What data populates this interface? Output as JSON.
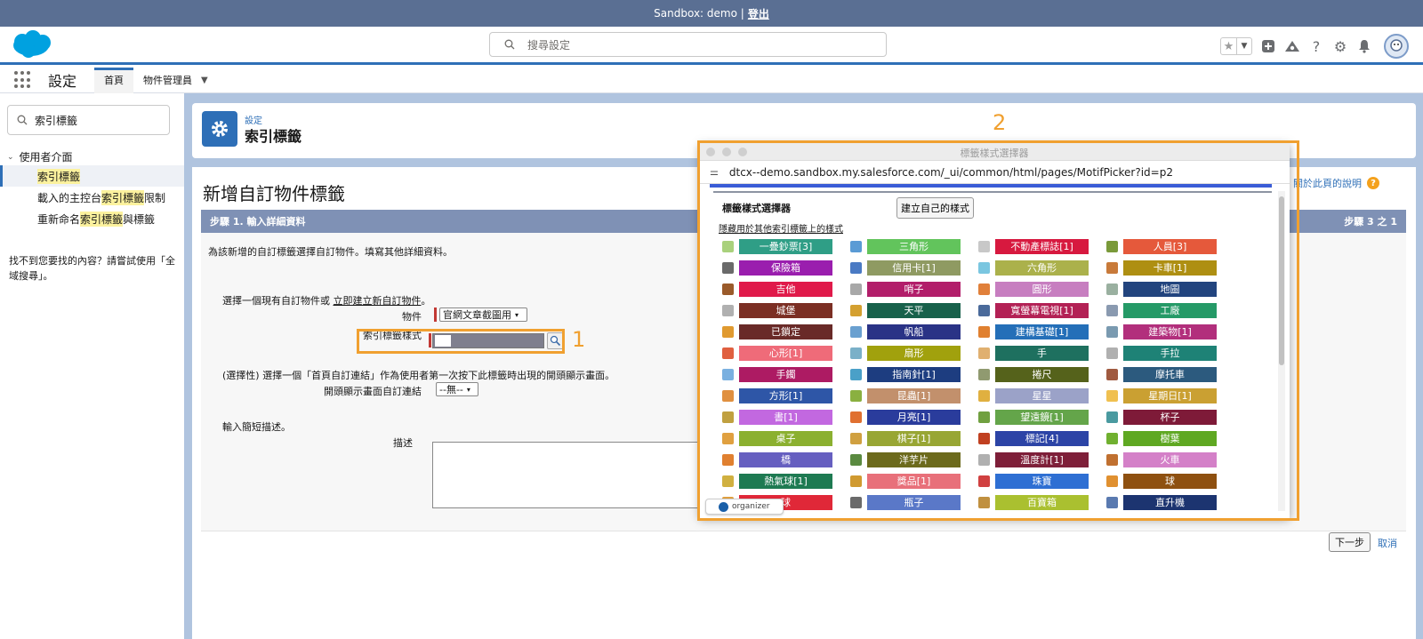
{
  "sandbox": {
    "label": "Sandbox: demo |",
    "logout": "登出"
  },
  "header": {
    "search_placeholder": "搜尋設定"
  },
  "nav": {
    "app_name": "設定",
    "tabs": [
      {
        "label": "首頁"
      },
      {
        "label": "物件管理員"
      }
    ]
  },
  "sidebar": {
    "quickfind_value": "索引標籤",
    "section": "使用者介面",
    "items": [
      {
        "before": "",
        "highlight": "索引標籤",
        "after": ""
      },
      {
        "before": "載入的主控台",
        "highlight": "索引標籤",
        "after": "限制"
      },
      {
        "before": "重新命名",
        "highlight": "索引標籤",
        "after": "與標籤"
      }
    ],
    "not_found": "找不到您要找的內容？請嘗試使用「全域搜尋」。"
  },
  "setup_header": {
    "subtitle": "設定",
    "title": "索引標籤"
  },
  "main": {
    "title": "新增自訂物件標籤",
    "help": "關於此頁的說明",
    "step_title": "步驟 1. 輸入詳細資料",
    "step_count": "步驟 3 之 1",
    "instructions": "為該新增的自訂標籤選擇自訂物件。填寫其他詳細資料。",
    "choose_prefix": "選擇一個現有自訂物件或",
    "choose_link": "立即建立新自訂物件",
    "choose_suffix": "。",
    "object_label": "物件",
    "object_value": "官網文章截圖用",
    "motif_label": "索引標籤樣式",
    "optional_text": "(選擇性) 選擇一個「首頁自訂連結」作為使用者第一次按下此標籤時出現的開頭顯示畫面。",
    "splash_label": "開頭顯示畫面自訂連結",
    "splash_value": "--無--",
    "desc_prompt": "輸入簡短描述。",
    "desc_label": "描述",
    "next": "下一步",
    "cancel": "取消"
  },
  "annotations": {
    "one": "1",
    "two": "2"
  },
  "popup": {
    "window_title": "標籤樣式選擇器",
    "url": "dtcx--demo.sandbox.my.salesforce.com/_ui/common/html/pages/MotifPicker?id=p2",
    "picker_title": "標籤樣式選擇器",
    "create_button": "建立自己的樣式",
    "hide_link": "隱藏用於其他索引標籤上的樣式",
    "styles": [
      {
        "label": "一疊鈔票[3]",
        "color": "#2f9e86",
        "icon": "#a9d17c"
      },
      {
        "label": "三角形",
        "color": "#62c45c",
        "icon": "#5a9bd5"
      },
      {
        "label": "不動產標誌[1]",
        "color": "#d7193f",
        "icon": "#c8c8c8"
      },
      {
        "label": "人員[3]",
        "color": "#e5593b",
        "icon": "#7a9a3a"
      },
      {
        "label": "保險箱",
        "color": "#9a1eae",
        "icon": "#6a6a6a"
      },
      {
        "label": "信用卡[1]",
        "color": "#8f9a62",
        "icon": "#4a7ac4"
      },
      {
        "label": "六角形",
        "color": "#abb14b",
        "icon": "#7ac6e0"
      },
      {
        "label": "卡車[1]",
        "color": "#ae8f12",
        "icon": "#c87a3a"
      },
      {
        "label": "吉他",
        "color": "#e01a4a",
        "icon": "#9a5a2a"
      },
      {
        "label": "哨子",
        "color": "#b21e6a",
        "icon": "#a8a8a8"
      },
      {
        "label": "圓形",
        "color": "#c77ec0",
        "icon": "#e0803a"
      },
      {
        "label": "地圖",
        "color": "#22447e",
        "icon": "#9ab0a0"
      },
      {
        "label": "城堡",
        "color": "#7b2f24",
        "icon": "#b0b0b0"
      },
      {
        "label": "天平",
        "color": "#18614b",
        "icon": "#d4a030"
      },
      {
        "label": "寬螢幕電視[1]",
        "color": "#b32155",
        "icon": "#4a6a9a"
      },
      {
        "label": "工廠",
        "color": "#259a67",
        "icon": "#8a9ab0"
      },
      {
        "label": "已鎖定",
        "color": "#692a28",
        "icon": "#e09a30"
      },
      {
        "label": "帆船",
        "color": "#2a3386",
        "icon": "#6aa0d0"
      },
      {
        "label": "建構基礎[1]",
        "color": "#246fb8",
        "icon": "#e08030"
      },
      {
        "label": "建築物[1]",
        "color": "#b22f7c",
        "icon": "#7a9ab0"
      },
      {
        "label": "心形[1]",
        "color": "#ef6b79",
        "icon": "#e06040"
      },
      {
        "label": "扇形",
        "color": "#a1a10d",
        "icon": "#7ab0c8"
      },
      {
        "label": "手",
        "color": "#1e705f",
        "icon": "#e0b070"
      },
      {
        "label": "手拉",
        "color": "#1e8276",
        "icon": "#b0b0b0"
      },
      {
        "label": "手鐲",
        "color": "#ad1b63",
        "icon": "#7ab0e0"
      },
      {
        "label": "指南針[1]",
        "color": "#1d3d80",
        "icon": "#4aa0c8"
      },
      {
        "label": "捲尺",
        "color": "#55621b",
        "icon": "#909a70"
      },
      {
        "label": "摩托車",
        "color": "#2c5a7e",
        "icon": "#a05a40"
      },
      {
        "label": "方形[1]",
        "color": "#2e56a7",
        "icon": "#e09040"
      },
      {
        "label": "昆蟲[1]",
        "color": "#c2906c",
        "icon": "#8ab040"
      },
      {
        "label": "星星",
        "color": "#9ba2c8",
        "icon": "#e0b040"
      },
      {
        "label": "星期日[1]",
        "color": "#caa032",
        "icon": "#f0c050"
      },
      {
        "label": "書[1]",
        "color": "#c268e0",
        "icon": "#c0a040"
      },
      {
        "label": "月亮[1]",
        "color": "#2a3c9c",
        "icon": "#e07030"
      },
      {
        "label": "望遠鏡[1]",
        "color": "#64a54a",
        "icon": "#70a040"
      },
      {
        "label": "杯子",
        "color": "#7e1a38",
        "icon": "#4a9aa0"
      },
      {
        "label": "桌子",
        "color": "#8bb030",
        "icon": "#e0a040"
      },
      {
        "label": "棋子[1]",
        "color": "#98a634",
        "icon": "#d0a040"
      },
      {
        "label": "標記[4]",
        "color": "#2c44a6",
        "icon": "#c04020"
      },
      {
        "label": "樹葉",
        "color": "#5fa822",
        "icon": "#70b030"
      },
      {
        "label": "橋",
        "color": "#665fc0",
        "icon": "#e08030"
      },
      {
        "label": "洋芋片",
        "color": "#6c6a1c",
        "icon": "#5a8a40"
      },
      {
        "label": "溫度計[1]",
        "color": "#7e1f39",
        "icon": "#b0b0b0"
      },
      {
        "label": "火車",
        "color": "#d480c8",
        "icon": "#c07030"
      },
      {
        "label": "熱氣球[1]",
        "color": "#1e7a52",
        "icon": "#d0b040"
      },
      {
        "label": "獎品[1]",
        "color": "#e8707a",
        "icon": "#d09a30"
      },
      {
        "label": "珠寶",
        "color": "#2e6fd3",
        "icon": "#d04040"
      },
      {
        "label": "球",
        "color": "#8e5010",
        "icon": "#e09030"
      },
      {
        "label": "球",
        "color": "#e02838",
        "icon": "#e0a040"
      },
      {
        "label": "瓶子",
        "color": "#5a78c8",
        "icon": "#6a6a6a"
      },
      {
        "label": "百寶箱",
        "color": "#aac030",
        "icon": "#c09040"
      },
      {
        "label": "直升機",
        "color": "#1c3470",
        "icon": "#5a7ab0"
      }
    ]
  },
  "organizer": {
    "label": "organizer"
  }
}
